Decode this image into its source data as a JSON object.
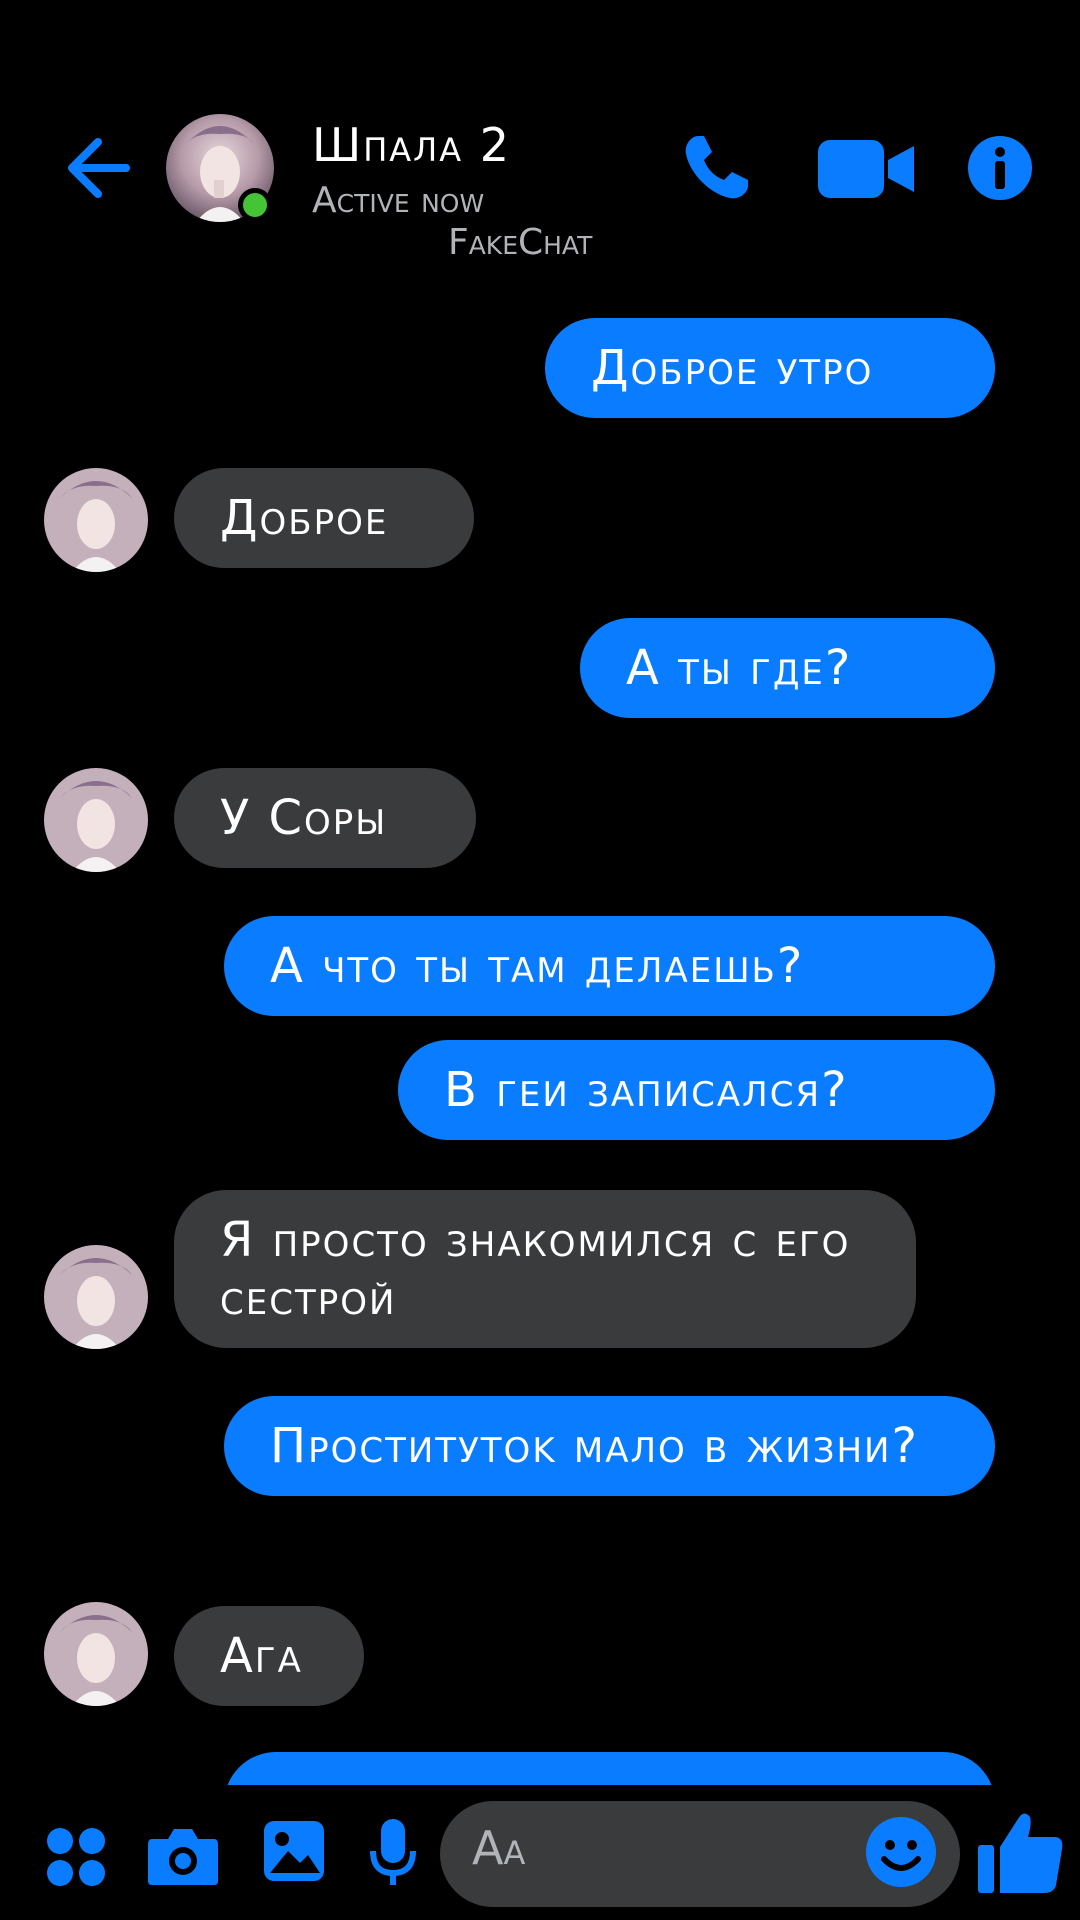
{
  "header": {
    "contact_name": "Шпала 2",
    "status": "Active now",
    "watermark": "FakeChat"
  },
  "colors": {
    "accent": "#0a7cff",
    "incoming_bubble": "#3a3b3c",
    "background": "#000000",
    "online": "#43c535",
    "muted_text": "#b0b3b8"
  },
  "icons": {
    "back": "arrow-left-icon",
    "call": "phone-icon",
    "video": "video-camera-icon",
    "info": "info-icon",
    "apps": "four-dots-icon",
    "camera": "camera-icon",
    "gallery": "image-icon",
    "mic": "microphone-icon",
    "emoji": "smiley-icon",
    "like": "thumbs-up-icon"
  },
  "messages": [
    {
      "direction": "out",
      "text": "Доброе утро"
    },
    {
      "direction": "in",
      "text": "Доброе"
    },
    {
      "direction": "out",
      "text": "А ты где?"
    },
    {
      "direction": "in",
      "text": "У Соры"
    },
    {
      "direction": "out",
      "text": "А что ты там делаешь?"
    },
    {
      "direction": "out",
      "text": "В геи записался?"
    },
    {
      "direction": "in",
      "text": "Я просто знакомился с его сестрой"
    },
    {
      "direction": "out",
      "text": "Проститутоk мало в жизни?"
    },
    {
      "direction": "in",
      "text": "Ага"
    },
    {
      "direction": "out",
      "text": ""
    }
  ],
  "composer": {
    "placeholder": "Aa"
  }
}
